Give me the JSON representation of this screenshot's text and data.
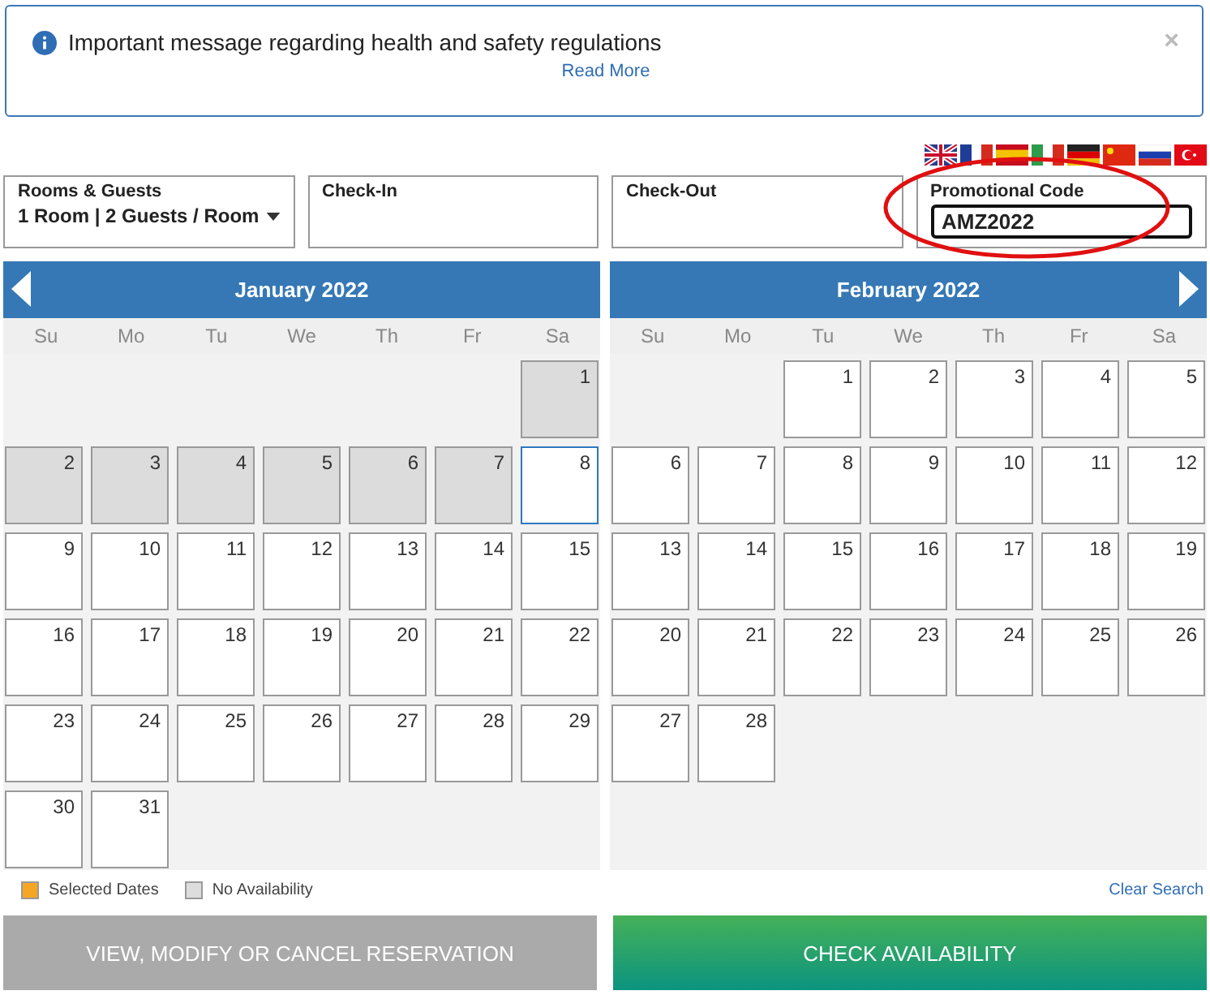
{
  "notice": {
    "message": "Important message regarding health and safety regulations",
    "link": "Read More",
    "close": "×"
  },
  "languages": [
    {
      "kind": "uk"
    },
    {
      "kind": "fr"
    },
    {
      "kind": "es"
    },
    {
      "kind": "it"
    },
    {
      "kind": "de"
    },
    {
      "kind": "cn"
    },
    {
      "kind": "ru"
    },
    {
      "kind": "tr"
    }
  ],
  "fields": [
    {
      "label": "Rooms & Guests",
      "value": "1 Room | 2 Guests / Room",
      "kind": "dropdown"
    },
    {
      "label": "Check-In",
      "kind": "plain"
    },
    {
      "label": "Check-Out",
      "kind": "plain"
    },
    {
      "label": "Promotional Code",
      "value": "AMZ2022",
      "kind": "input",
      "focused": true,
      "circled": true
    }
  ],
  "calendars": [
    {
      "title": "January 2022",
      "prev_arrow": true,
      "next_arrow": false,
      "weekdays": [
        "Su",
        "Mo",
        "Tu",
        "We",
        "Th",
        "Fr",
        "Sa"
      ],
      "days": [
        {
          "kind": "blank"
        },
        {
          "kind": "blank"
        },
        {
          "kind": "blank"
        },
        {
          "kind": "blank"
        },
        {
          "kind": "blank"
        },
        {
          "kind": "blank"
        },
        {
          "kind": "day",
          "label": "1",
          "unavailable": true,
          "highlighted": false
        },
        {
          "kind": "day",
          "label": "2",
          "unavailable": true,
          "highlighted": false
        },
        {
          "kind": "day",
          "label": "3",
          "unavailable": true,
          "highlighted": false
        },
        {
          "kind": "day",
          "label": "4",
          "unavailable": true,
          "highlighted": false
        },
        {
          "kind": "day",
          "label": "5",
          "unavailable": true,
          "highlighted": false
        },
        {
          "kind": "day",
          "label": "6",
          "unavailable": true,
          "highlighted": false
        },
        {
          "kind": "day",
          "label": "7",
          "unavailable": true,
          "highlighted": false
        },
        {
          "kind": "day",
          "label": "8",
          "unavailable": false,
          "highlighted": true
        },
        {
          "kind": "day",
          "label": "9",
          "unavailable": false,
          "highlighted": false
        },
        {
          "kind": "day",
          "label": "10",
          "unavailable": false,
          "highlighted": false
        },
        {
          "kind": "day",
          "label": "11",
          "unavailable": false,
          "highlighted": false
        },
        {
          "kind": "day",
          "label": "12",
          "unavailable": false,
          "highlighted": false
        },
        {
          "kind": "day",
          "label": "13",
          "unavailable": false,
          "highlighted": false
        },
        {
          "kind": "day",
          "label": "14",
          "unavailable": false,
          "highlighted": false
        },
        {
          "kind": "day",
          "label": "15",
          "unavailable": false,
          "highlighted": false
        },
        {
          "kind": "day",
          "label": "16",
          "unavailable": false,
          "highlighted": false
        },
        {
          "kind": "day",
          "label": "17",
          "unavailable": false,
          "highlighted": false
        },
        {
          "kind": "day",
          "label": "18",
          "unavailable": false,
          "highlighted": false
        },
        {
          "kind": "day",
          "label": "19",
          "unavailable": false,
          "highlighted": false
        },
        {
          "kind": "day",
          "label": "20",
          "unavailable": false,
          "highlighted": false
        },
        {
          "kind": "day",
          "label": "21",
          "unavailable": false,
          "highlighted": false
        },
        {
          "kind": "day",
          "label": "22",
          "unavailable": false,
          "highlighted": false
        },
        {
          "kind": "day",
          "label": "23",
          "unavailable": false,
          "highlighted": false
        },
        {
          "kind": "day",
          "label": "24",
          "unavailable": false,
          "highlighted": false
        },
        {
          "kind": "day",
          "label": "25",
          "unavailable": false,
          "highlighted": false
        },
        {
          "kind": "day",
          "label": "26",
          "unavailable": false,
          "highlighted": false
        },
        {
          "kind": "day",
          "label": "27",
          "unavailable": false,
          "highlighted": false
        },
        {
          "kind": "day",
          "label": "28",
          "unavailable": false,
          "highlighted": false
        },
        {
          "kind": "day",
          "label": "29",
          "unavailable": false,
          "highlighted": false
        },
        {
          "kind": "day",
          "label": "30",
          "unavailable": false,
          "highlighted": false
        },
        {
          "kind": "day",
          "label": "31",
          "unavailable": false,
          "highlighted": false
        }
      ]
    },
    {
      "title": "February 2022",
      "prev_arrow": false,
      "next_arrow": true,
      "weekdays": [
        "Su",
        "Mo",
        "Tu",
        "We",
        "Th",
        "Fr",
        "Sa"
      ],
      "days": [
        {
          "kind": "blank"
        },
        {
          "kind": "blank"
        },
        {
          "kind": "day",
          "label": "1",
          "unavailable": false,
          "highlighted": false
        },
        {
          "kind": "day",
          "label": "2",
          "unavailable": false,
          "highlighted": false
        },
        {
          "kind": "day",
          "label": "3",
          "unavailable": false,
          "highlighted": false
        },
        {
          "kind": "day",
          "label": "4",
          "unavailable": false,
          "highlighted": false
        },
        {
          "kind": "day",
          "label": "5",
          "unavailable": false,
          "highlighted": false
        },
        {
          "kind": "day",
          "label": "6",
          "unavailable": false,
          "highlighted": false
        },
        {
          "kind": "day",
          "label": "7",
          "unavailable": false,
          "highlighted": false
        },
        {
          "kind": "day",
          "label": "8",
          "unavailable": false,
          "highlighted": false
        },
        {
          "kind": "day",
          "label": "9",
          "unavailable": false,
          "highlighted": false
        },
        {
          "kind": "day",
          "label": "10",
          "unavailable": false,
          "highlighted": false
        },
        {
          "kind": "day",
          "label": "11",
          "unavailable": false,
          "highlighted": false
        },
        {
          "kind": "day",
          "label": "12",
          "unavailable": false,
          "highlighted": false
        },
        {
          "kind": "day",
          "label": "13",
          "unavailable": false,
          "highlighted": false
        },
        {
          "kind": "day",
          "label": "14",
          "unavailable": false,
          "highlighted": false
        },
        {
          "kind": "day",
          "label": "15",
          "unavailable": false,
          "highlighted": false
        },
        {
          "kind": "day",
          "label": "16",
          "unavailable": false,
          "highlighted": false
        },
        {
          "kind": "day",
          "label": "17",
          "unavailable": false,
          "highlighted": false
        },
        {
          "kind": "day",
          "label": "18",
          "unavailable": false,
          "highlighted": false
        },
        {
          "kind": "day",
          "label": "19",
          "unavailable": false,
          "highlighted": false
        },
        {
          "kind": "day",
          "label": "20",
          "unavailable": false,
          "highlighted": false
        },
        {
          "kind": "day",
          "label": "21",
          "unavailable": false,
          "highlighted": false
        },
        {
          "kind": "day",
          "label": "22",
          "unavailable": false,
          "highlighted": false
        },
        {
          "kind": "day",
          "label": "23",
          "unavailable": false,
          "highlighted": false
        },
        {
          "kind": "day",
          "label": "24",
          "unavailable": false,
          "highlighted": false
        },
        {
          "kind": "day",
          "label": "25",
          "unavailable": false,
          "highlighted": false
        },
        {
          "kind": "day",
          "label": "26",
          "unavailable": false,
          "highlighted": false
        },
        {
          "kind": "day",
          "label": "27",
          "unavailable": false,
          "highlighted": false
        },
        {
          "kind": "day",
          "label": "28",
          "unavailable": false,
          "highlighted": false
        }
      ]
    }
  ],
  "legend": [
    {
      "label": "Selected Dates",
      "color": "#f5a623"
    },
    {
      "label": "No Availability",
      "color": "#dddddd"
    }
  ],
  "clear_search": "Clear Search",
  "buttons": [
    {
      "label": "VIEW, MODIFY OR CANCEL RESERVATION",
      "kind": "secondary"
    },
    {
      "label": "CHECK AVAILABILITY",
      "kind": "primary"
    }
  ]
}
